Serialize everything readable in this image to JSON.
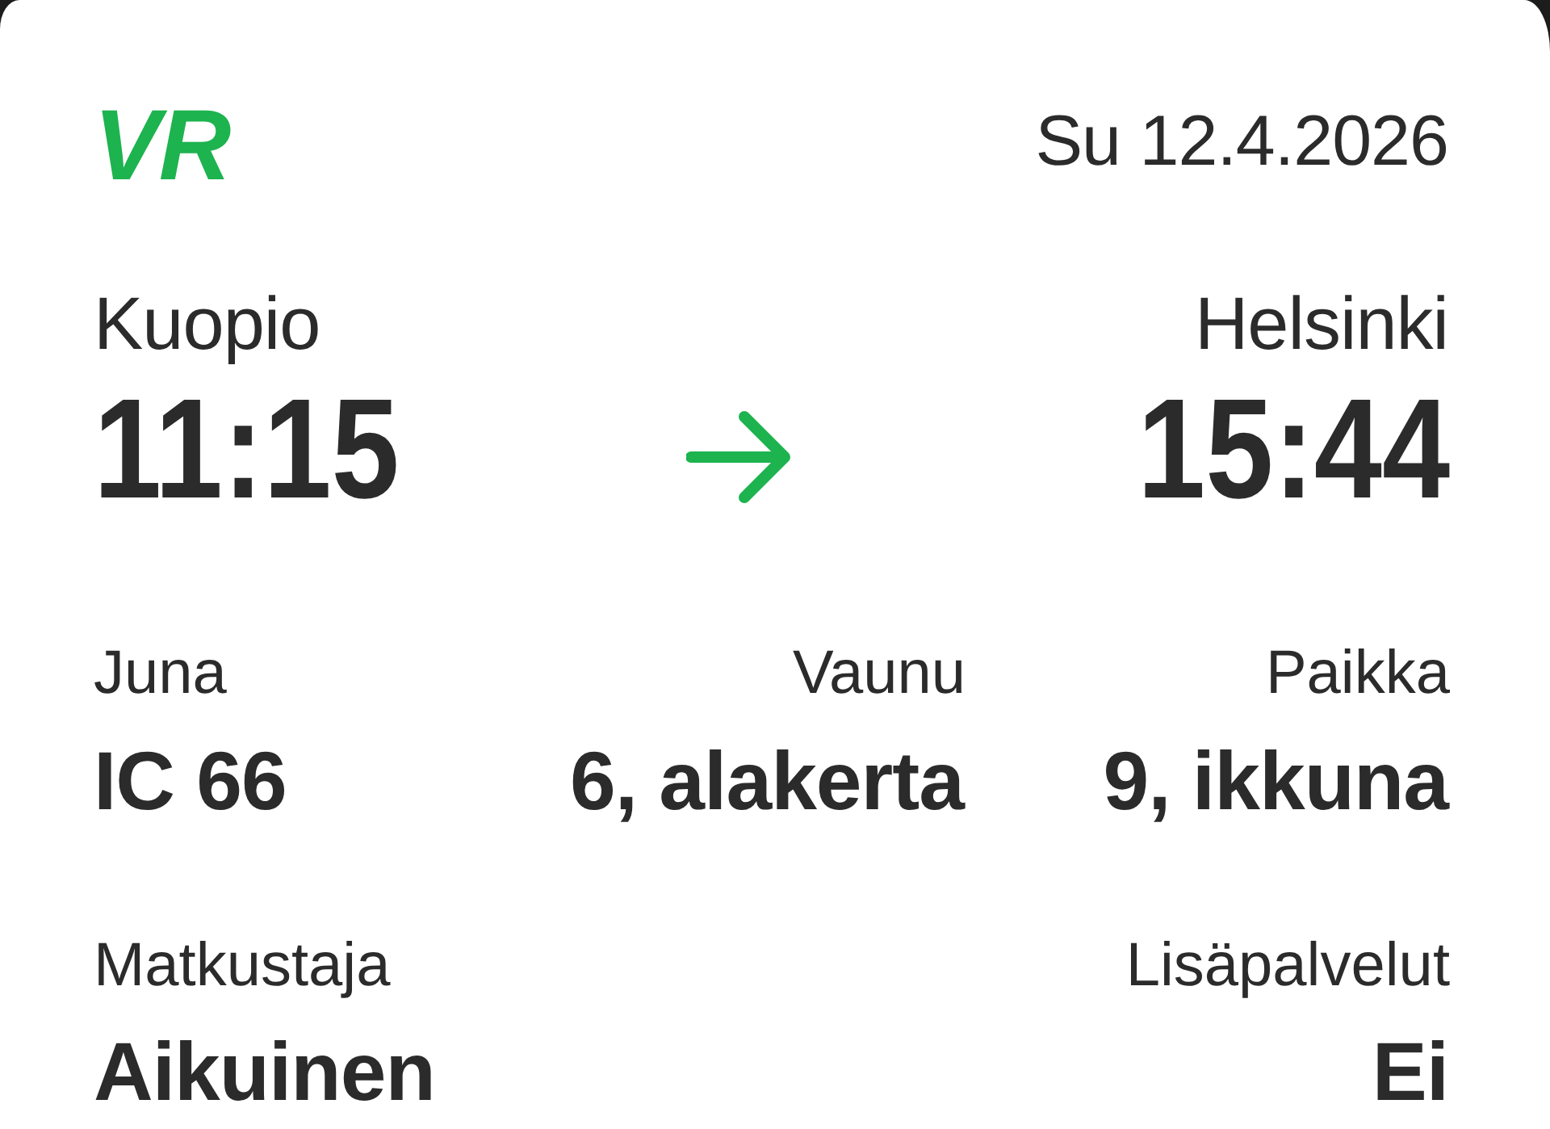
{
  "logo": "VR",
  "date": "Su 12.4.2026",
  "journey": {
    "origin": {
      "station": "Kuopio",
      "time": "11:15"
    },
    "destination": {
      "station": "Helsinki",
      "time": "15:44"
    }
  },
  "details": [
    [
      {
        "label": "Juna",
        "value": "IC 66"
      },
      {
        "label": "Vaunu",
        "value": "6, alakerta"
      },
      {
        "label": "Paikka",
        "value": "9, ikkuna"
      }
    ],
    [
      {
        "label": "Matkustaja",
        "value": "Aikuinen"
      },
      {
        "label": "Lisäpalvelut",
        "value": "Ei"
      }
    ]
  ]
}
